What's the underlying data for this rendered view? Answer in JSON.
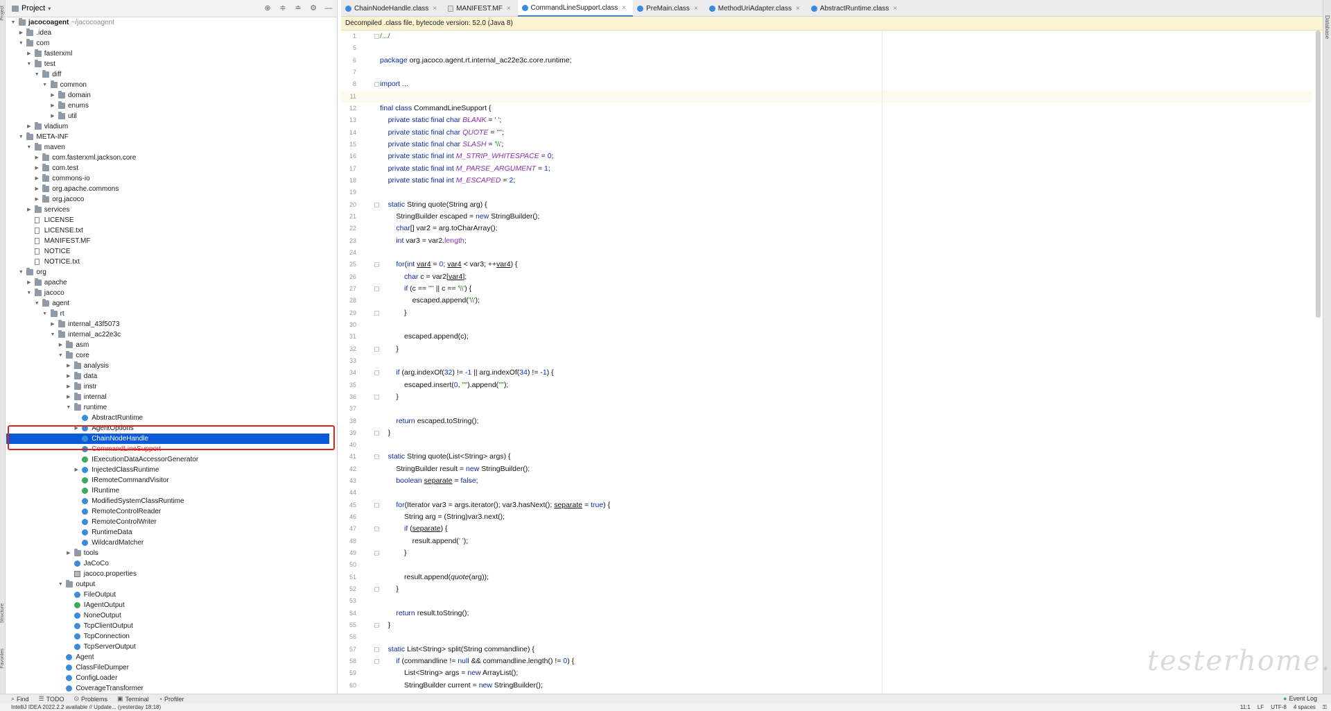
{
  "project_panel": {
    "title": "Project",
    "tools": [
      "locate-icon",
      "expand-all-icon",
      "collapse-all-icon",
      "gear-icon",
      "minimize-icon"
    ],
    "tree": [
      {
        "d": 0,
        "a": "open",
        "i": "folder",
        "t": "jacocoagent",
        "sub": "~/jacocoagent",
        "bold": true
      },
      {
        "d": 1,
        "a": "closed",
        "i": "folder",
        "t": ".idea"
      },
      {
        "d": 1,
        "a": "open",
        "i": "folder",
        "t": "com"
      },
      {
        "d": 2,
        "a": "closed",
        "i": "folder",
        "t": "fasterxml"
      },
      {
        "d": 2,
        "a": "open",
        "i": "folder",
        "t": "test"
      },
      {
        "d": 3,
        "a": "open",
        "i": "folder",
        "t": "diff"
      },
      {
        "d": 4,
        "a": "open",
        "i": "folder",
        "t": "common"
      },
      {
        "d": 5,
        "a": "closed",
        "i": "folder",
        "t": "domain"
      },
      {
        "d": 5,
        "a": "closed",
        "i": "folder",
        "t": "enums"
      },
      {
        "d": 5,
        "a": "closed",
        "i": "folder",
        "t": "util"
      },
      {
        "d": 2,
        "a": "closed",
        "i": "folder",
        "t": "vladium"
      },
      {
        "d": 1,
        "a": "open",
        "i": "folder",
        "t": "META-INF"
      },
      {
        "d": 2,
        "a": "open",
        "i": "folder",
        "t": "maven"
      },
      {
        "d": 3,
        "a": "closed",
        "i": "folder",
        "t": "com.fasterxml.jackson.core"
      },
      {
        "d": 3,
        "a": "closed",
        "i": "folder",
        "t": "com.test"
      },
      {
        "d": 3,
        "a": "closed",
        "i": "folder",
        "t": "commons-io"
      },
      {
        "d": 3,
        "a": "closed",
        "i": "folder",
        "t": "org.apache.commons"
      },
      {
        "d": 3,
        "a": "closed",
        "i": "folder",
        "t": "org.jacoco"
      },
      {
        "d": 2,
        "a": "closed",
        "i": "folder",
        "t": "services"
      },
      {
        "d": 2,
        "a": "none",
        "i": "file",
        "t": "LICENSE"
      },
      {
        "d": 2,
        "a": "none",
        "i": "file",
        "t": "LICENSE.txt"
      },
      {
        "d": 2,
        "a": "none",
        "i": "file",
        "t": "MANIFEST.MF"
      },
      {
        "d": 2,
        "a": "none",
        "i": "file",
        "t": "NOTICE"
      },
      {
        "d": 2,
        "a": "none",
        "i": "file",
        "t": "NOTICE.txt"
      },
      {
        "d": 1,
        "a": "open",
        "i": "folder",
        "t": "org"
      },
      {
        "d": 2,
        "a": "closed",
        "i": "folder",
        "t": "apache"
      },
      {
        "d": 2,
        "a": "open",
        "i": "folder",
        "t": "jacoco"
      },
      {
        "d": 3,
        "a": "open",
        "i": "folder",
        "t": "agent"
      },
      {
        "d": 4,
        "a": "open",
        "i": "folder",
        "t": "rt"
      },
      {
        "d": 5,
        "a": "closed",
        "i": "folder",
        "t": "internal_43f5073"
      },
      {
        "d": 5,
        "a": "open",
        "i": "folder",
        "t": "internal_ac22e3c"
      },
      {
        "d": 6,
        "a": "closed",
        "i": "folder",
        "t": "asm"
      },
      {
        "d": 6,
        "a": "open",
        "i": "folder",
        "t": "core"
      },
      {
        "d": 7,
        "a": "closed",
        "i": "folder",
        "t": "analysis"
      },
      {
        "d": 7,
        "a": "closed",
        "i": "folder",
        "t": "data"
      },
      {
        "d": 7,
        "a": "closed",
        "i": "folder",
        "t": "instr"
      },
      {
        "d": 7,
        "a": "closed",
        "i": "folder",
        "t": "internal"
      },
      {
        "d": 7,
        "a": "open",
        "i": "folder",
        "t": "runtime"
      },
      {
        "d": 8,
        "a": "none",
        "i": "class",
        "t": "AbstractRuntime"
      },
      {
        "d": 8,
        "a": "closed",
        "i": "class",
        "t": "AgentOptions"
      },
      {
        "d": 8,
        "a": "none",
        "i": "class",
        "t": "ChainNodeHandle",
        "selected": true
      },
      {
        "d": 8,
        "a": "none",
        "i": "class",
        "t": "CommandLineSupport",
        "strike": true
      },
      {
        "d": 8,
        "a": "none",
        "i": "class-green",
        "t": "IExecutionDataAccessorGenerator"
      },
      {
        "d": 8,
        "a": "closed",
        "i": "class",
        "t": "InjectedClassRuntime"
      },
      {
        "d": 8,
        "a": "none",
        "i": "class-green",
        "t": "IRemoteCommandVisitor"
      },
      {
        "d": 8,
        "a": "none",
        "i": "class-green",
        "t": "IRuntime"
      },
      {
        "d": 8,
        "a": "none",
        "i": "class",
        "t": "ModifiedSystemClassRuntime"
      },
      {
        "d": 8,
        "a": "none",
        "i": "class",
        "t": "RemoteControlReader"
      },
      {
        "d": 8,
        "a": "none",
        "i": "class",
        "t": "RemoteControlWriter"
      },
      {
        "d": 8,
        "a": "none",
        "i": "class",
        "t": "RuntimeData"
      },
      {
        "d": 8,
        "a": "none",
        "i": "class",
        "t": "WildcardMatcher"
      },
      {
        "d": 7,
        "a": "closed",
        "i": "folder",
        "t": "tools"
      },
      {
        "d": 7,
        "a": "none",
        "i": "class",
        "t": "JaCoCo"
      },
      {
        "d": 7,
        "a": "none",
        "i": "props",
        "t": "jacoco.properties"
      },
      {
        "d": 6,
        "a": "open",
        "i": "folder",
        "t": "output"
      },
      {
        "d": 7,
        "a": "none",
        "i": "class",
        "t": "FileOutput"
      },
      {
        "d": 7,
        "a": "none",
        "i": "class-green",
        "t": "IAgentOutput"
      },
      {
        "d": 7,
        "a": "none",
        "i": "class",
        "t": "NoneOutput"
      },
      {
        "d": 7,
        "a": "none",
        "i": "class",
        "t": "TcpClientOutput"
      },
      {
        "d": 7,
        "a": "none",
        "i": "class",
        "t": "TcpConnection"
      },
      {
        "d": 7,
        "a": "none",
        "i": "class",
        "t": "TcpServerOutput"
      },
      {
        "d": 6,
        "a": "none",
        "i": "class",
        "t": "Agent"
      },
      {
        "d": 6,
        "a": "none",
        "i": "class",
        "t": "ClassFileDumper"
      },
      {
        "d": 6,
        "a": "none",
        "i": "class",
        "t": "ConfigLoader"
      },
      {
        "d": 6,
        "a": "none",
        "i": "class",
        "t": "CoverageTransformer"
      }
    ]
  },
  "tabs": [
    {
      "label": "ChainNodeHandle.class",
      "icon": "class",
      "active": false
    },
    {
      "label": "MANIFEST.MF",
      "icon": "mf",
      "active": false
    },
    {
      "label": "CommandLineSupport.class",
      "icon": "class",
      "active": true
    },
    {
      "label": "PreMain.class",
      "icon": "class",
      "active": false
    },
    {
      "label": "MethodUriAdapter.class",
      "icon": "class",
      "active": false
    },
    {
      "label": "AbstractRuntime.class",
      "icon": "class",
      "active": false
    }
  ],
  "banner": "Decompiled .class file, bytecode version: 52.0 (Java 8)",
  "code": [
    {
      "n": "1",
      "fold": true,
      "h": "<span class=\"cm\">/.../</span>"
    },
    {
      "n": "5",
      "h": ""
    },
    {
      "n": "6",
      "h": "<span class=\"k\">package</span> org.jacoco.agent.rt.internal_ac22e3c.core.runtime;"
    },
    {
      "n": "7",
      "h": ""
    },
    {
      "n": "8",
      "fold": true,
      "h": "<span class=\"k\">import</span> <span class=\"cm\">...</span>"
    },
    {
      "n": "11",
      "cur": true,
      "h": ""
    },
    {
      "n": "12",
      "h": "<span class=\"k\">final class</span> CommandLineSupport {"
    },
    {
      "n": "13",
      "h": "    <span class=\"k\">private static final char</span> <span class=\"c\">BLANK</span> = <span class=\"s\">' '</span>;"
    },
    {
      "n": "14",
      "h": "    <span class=\"k\">private static final char</span> <span class=\"c\">QUOTE</span> = <span class=\"s\">'\"'</span>;"
    },
    {
      "n": "15",
      "h": "    <span class=\"k\">private static final char</span> <span class=\"c\">SLASH</span> = <span class=\"s\">'\\\\'</span>;"
    },
    {
      "n": "16",
      "h": "    <span class=\"k\">private static final int</span> <span class=\"c\">M_STRIP_WHITESPACE</span> = <span class=\"n\">0</span>;"
    },
    {
      "n": "17",
      "h": "    <span class=\"k\">private static final int</span> <span class=\"c\">M_PARSE_ARGUMENT</span> = <span class=\"n\">1</span>;"
    },
    {
      "n": "18",
      "h": "    <span class=\"k\">private static final int</span> <span class=\"c\">M_ESCAPED</span> = <span class=\"n\">2</span>;"
    },
    {
      "n": "19",
      "h": ""
    },
    {
      "n": "20",
      "fold": true,
      "h": "    <span class=\"k\">static</span> String quote(String arg) {"
    },
    {
      "n": "21",
      "h": "        StringBuilder escaped = <span class=\"k\">new</span> StringBuilder();"
    },
    {
      "n": "22",
      "h": "        <span class=\"k\">char</span>[] var2 = arg.toCharArray();"
    },
    {
      "n": "23",
      "h": "        <span class=\"k\">int</span> var3 = var2.<span class=\"c\" style=\"font-style:normal\">length</span>;"
    },
    {
      "n": "24",
      "h": ""
    },
    {
      "n": "25",
      "fold": true,
      "h": "        <span class=\"k\">for</span>(<span class=\"k\">int</span> <span class=\"u\">var4</span> = <span class=\"n\">0</span>; <span class=\"u\">var4</span> &lt; var3; ++<span class=\"u\">var4</span>) {"
    },
    {
      "n": "26",
      "h": "            <span class=\"k\">char</span> c = var2[<span class=\"u\">var4</span>];"
    },
    {
      "n": "27",
      "fold": true,
      "h": "            <span class=\"k\">if</span> (c == <span class=\"s\">'\"'</span> || c == <span class=\"s\">'\\\\'</span>) {"
    },
    {
      "n": "28",
      "h": "                escaped.append(<span class=\"s\">'\\\\'</span>);"
    },
    {
      "n": "29",
      "fold": true,
      "h": "            }"
    },
    {
      "n": "30",
      "h": ""
    },
    {
      "n": "31",
      "h": "            escaped.append(c);"
    },
    {
      "n": "32",
      "fold": true,
      "h": "        }"
    },
    {
      "n": "33",
      "h": ""
    },
    {
      "n": "34",
      "fold": true,
      "h": "        <span class=\"k\">if</span> (arg.indexOf(<span class=\"n\">32</span>) != -<span class=\"n\">1</span> || arg.indexOf(<span class=\"n\">34</span>) != -<span class=\"n\">1</span>) {"
    },
    {
      "n": "35",
      "h": "            escaped.insert(<span class=\"n\">0</span>, <span class=\"s\">'\"'</span>).append(<span class=\"s\">'\"'</span>);"
    },
    {
      "n": "36",
      "fold": true,
      "h": "        }"
    },
    {
      "n": "37",
      "h": ""
    },
    {
      "n": "38",
      "h": "        <span class=\"k\">return</span> escaped.toString();"
    },
    {
      "n": "39",
      "fold": true,
      "h": "    }"
    },
    {
      "n": "40",
      "h": ""
    },
    {
      "n": "41",
      "fold": true,
      "h": "    <span class=\"k\">static</span> String quote(List&lt;String&gt; args) {"
    },
    {
      "n": "42",
      "h": "        StringBuilder result = <span class=\"k\">new</span> StringBuilder();"
    },
    {
      "n": "43",
      "h": "        <span class=\"k\">boolean</span> <span class=\"u\">separate</span> = <span class=\"k\">false</span>;"
    },
    {
      "n": "44",
      "h": ""
    },
    {
      "n": "45",
      "fold": true,
      "h": "        <span class=\"k\">for</span>(Iterator var3 = args.iterator(); var3.hasNext(); <span class=\"u\">separate</span> = <span class=\"k\">true</span>) {"
    },
    {
      "n": "46",
      "h": "            String arg = (String)var3.next();"
    },
    {
      "n": "47",
      "fold": true,
      "h": "            <span class=\"k\">if</span> (<span class=\"u\">separate</span>) {"
    },
    {
      "n": "48",
      "h": "                result.append(<span class=\"s\">' '</span>);"
    },
    {
      "n": "49",
      "fold": true,
      "h": "            }"
    },
    {
      "n": "50",
      "h": ""
    },
    {
      "n": "51",
      "h": "            result.append(<span class=\"f\">quote</span>(arg));"
    },
    {
      "n": "52",
      "fold": true,
      "h": "        }"
    },
    {
      "n": "53",
      "h": ""
    },
    {
      "n": "54",
      "h": "        <span class=\"k\">return</span> result.toString();"
    },
    {
      "n": "55",
      "fold": true,
      "h": "    }"
    },
    {
      "n": "56",
      "h": ""
    },
    {
      "n": "57",
      "fold": true,
      "h": "    <span class=\"k\">static</span> List&lt;String&gt; split(String commandline) {"
    },
    {
      "n": "58",
      "fold": true,
      "h": "        <span class=\"k\">if</span> (commandline != <span class=\"k\">null</span> &amp;&amp; commandline.length() != <span class=\"n\">0</span>) {"
    },
    {
      "n": "59",
      "h": "            List&lt;String&gt; args = <span class=\"k\">new</span> ArrayList();"
    },
    {
      "n": "60",
      "h": "            StringBuilder current = <span class=\"k\">new</span> StringBuilder();"
    }
  ],
  "side_labels": {
    "left_top": "Project",
    "left_mid": "Structure",
    "left_bot": "Favorites",
    "right": "Database"
  },
  "bottom_tools": [
    {
      "icon": "search-icon",
      "glyph": "⌕",
      "label": "Find"
    },
    {
      "icon": "todo-icon",
      "glyph": "☰",
      "label": "TODO"
    },
    {
      "icon": "problems-icon",
      "glyph": "⊙",
      "label": "Problems"
    },
    {
      "icon": "terminal-icon",
      "glyph": "▣",
      "label": "Terminal"
    },
    {
      "icon": "profiler-icon",
      "glyph": "◔",
      "label": "Profiler"
    }
  ],
  "event_log": "Event Log",
  "status": {
    "message": "IntelliJ IDEA 2022.2.2 available // Update... (yesterday 18:18)",
    "position": "11:1",
    "line_sep": "LF",
    "encoding": "UTF-8",
    "indent": "4 spaces"
  },
  "watermark": "testerhome.com"
}
